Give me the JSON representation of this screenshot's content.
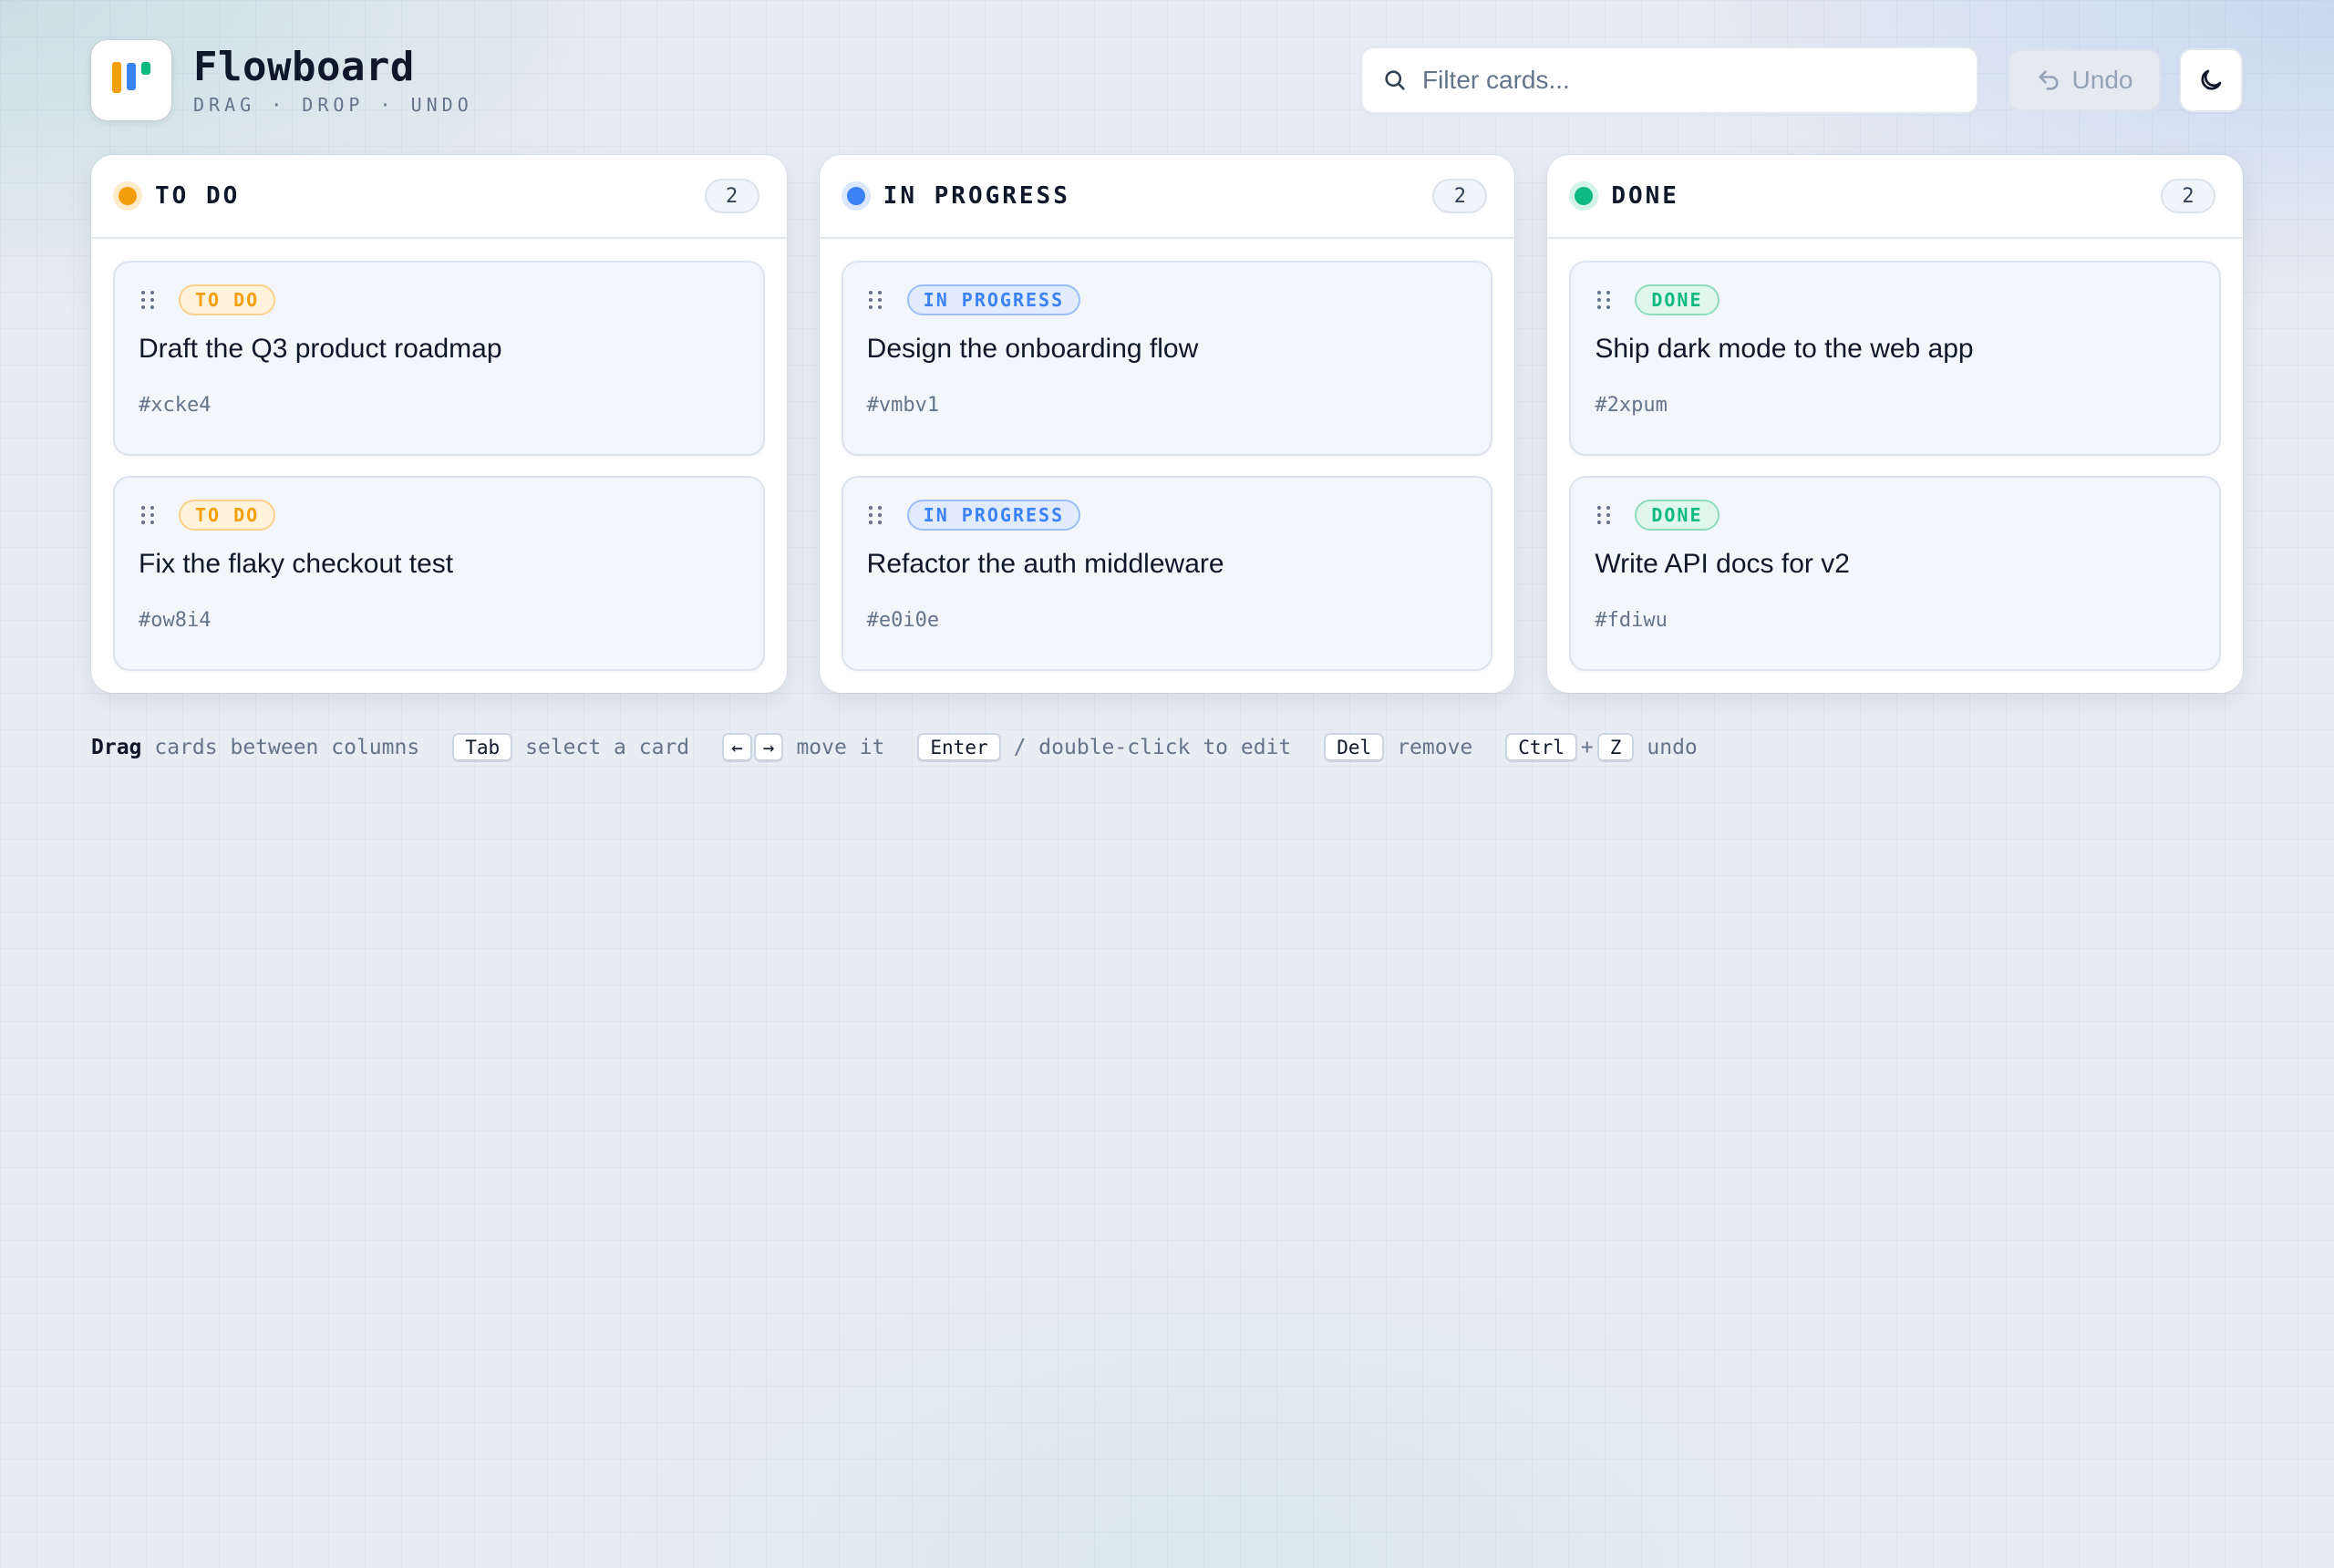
{
  "app": {
    "title": "Flowboard",
    "subtitle": "DRAG · DROP · UNDO"
  },
  "search": {
    "placeholder": "Filter cards...",
    "value": ""
  },
  "toolbar": {
    "undo_label": "Undo",
    "theme_icon": "moon-icon"
  },
  "colors": {
    "todo": "#f59e0b",
    "in_progress": "#3b82f6",
    "done": "#10b981"
  },
  "columns": [
    {
      "title": "TO DO",
      "count": "2",
      "cards": [
        {
          "badge": "TO DO",
          "title": "Draft the Q3 product roadmap",
          "id": "#xcke4"
        },
        {
          "badge": "TO DO",
          "title": "Fix the flaky checkout test",
          "id": "#ow8i4"
        }
      ]
    },
    {
      "title": "IN PROGRESS",
      "count": "2",
      "cards": [
        {
          "badge": "IN PROGRESS",
          "title": "Design the onboarding flow",
          "id": "#vmbv1"
        },
        {
          "badge": "IN PROGRESS",
          "title": "Refactor the auth middleware",
          "id": "#e0i0e"
        }
      ]
    },
    {
      "title": "DONE",
      "count": "2",
      "cards": [
        {
          "badge": "DONE",
          "title": "Ship dark mode to the web app",
          "id": "#2xpum"
        },
        {
          "badge": "DONE",
          "title": "Write API docs for v2",
          "id": "#fdiwu"
        }
      ]
    }
  ],
  "hints": {
    "drag_bold": "Drag",
    "drag_text": "cards between columns",
    "tab_key": "Tab",
    "tab_text": "select a card",
    "left_key": "←",
    "right_key": "→",
    "move_text": "move it",
    "enter_key": "Enter",
    "enter_text": "/ double-click to edit",
    "del_key": "Del",
    "del_text": "remove",
    "ctrl_key": "Ctrl",
    "plus": "+",
    "z_key": "Z",
    "undo_text": "undo"
  }
}
